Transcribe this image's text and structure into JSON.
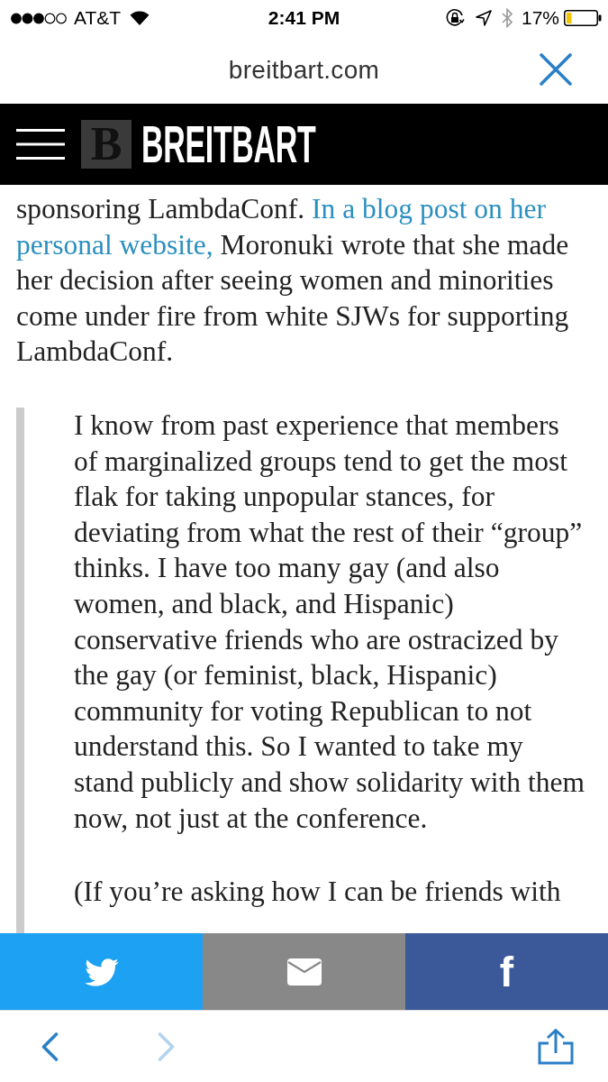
{
  "status_bar": {
    "carrier": "AT&T",
    "time": "2:41 PM",
    "battery": "17%"
  },
  "url_bar": {
    "url": "breitbart.com"
  },
  "header": {
    "logo_mark": "B",
    "logo_text": "BREITBART"
  },
  "article": {
    "paragraphs": [
      {
        "lines": [
          [
            {
              "kind": "text",
              "text": "sponsoring LambdaConf. "
            },
            {
              "kind": "link",
              "text": "In a blog post on her"
            }
          ],
          [
            {
              "kind": "link",
              "text": "personal website,"
            },
            {
              "kind": "text",
              "text": " Moronuki wrote that she made"
            }
          ],
          [
            {
              "kind": "text",
              "text": "her decision after seeing women and minorities"
            }
          ],
          [
            {
              "kind": "text",
              "text": "come under fire from white SJWs for supporting"
            }
          ],
          [
            {
              "kind": "text",
              "text": "LambdaConf."
            }
          ]
        ]
      }
    ],
    "blockquote": {
      "paragraphs": [
        {
          "lines": [
            "I know from past experience that members",
            "of marginalized groups tend to get the most",
            "flak for taking unpopular stances, for",
            "deviating from what the rest of their “group”",
            "thinks. I have too many gay (and also",
            "women, and black, and Hispanic)",
            "conservative friends who are ostracized by",
            "the gay (or feminist, black, Hispanic)",
            "community for voting Republican to not",
            "understand this. So I wanted to take my",
            "stand publicly and show solidarity with them",
            "now, not just at the conference."
          ]
        },
        {
          "lines": [
            "(If you’re asking how I can be friends with"
          ]
        }
      ]
    }
  },
  "share_bar": [
    {
      "kind": "twitter",
      "color": "#1da1f2"
    },
    {
      "kind": "email",
      "color": "#888888"
    },
    {
      "kind": "facebook",
      "color": "#3b5998",
      "label": "f"
    }
  ],
  "toolbar": [
    {
      "kind": "back",
      "disabled": false
    },
    {
      "kind": "forward",
      "disabled": true
    },
    {
      "kind": "share",
      "disabled": false
    }
  ]
}
